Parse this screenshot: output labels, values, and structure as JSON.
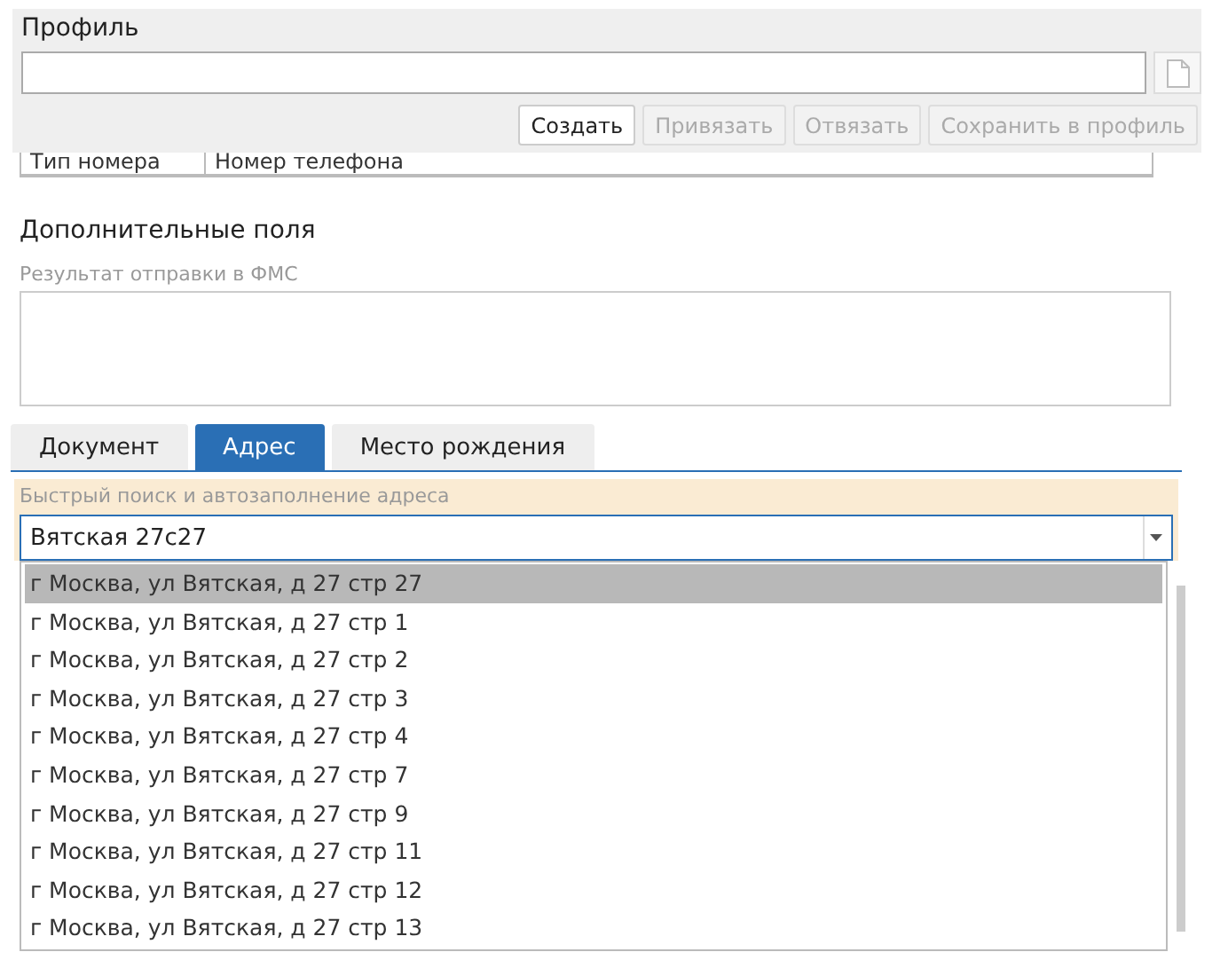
{
  "profile": {
    "title": "Профиль",
    "buttons": [
      {
        "label": "Создать",
        "disabled": false
      },
      {
        "label": "Привязать",
        "disabled": true
      },
      {
        "label": "Отвязать",
        "disabled": true
      },
      {
        "label": "Сохранить в профиль",
        "disabled": true
      }
    ]
  },
  "phone_table": {
    "columns": [
      "Тип номера",
      "Номер телефона"
    ]
  },
  "extra": {
    "title": "Дополнительные поля",
    "fms_label": "Результат отправки в ФМС"
  },
  "tabs": [
    {
      "label": "Документ",
      "selected": false
    },
    {
      "label": "Адрес",
      "selected": true
    },
    {
      "label": "Место рождения",
      "selected": false
    }
  ],
  "address": {
    "label": "Быстрый поиск и автозаполнение адреса",
    "value": "Вятская 27с27",
    "suggestions": [
      {
        "text": "г Москва, ул Вятская, д 27 стр 27",
        "selected": true
      },
      {
        "text": "г Москва, ул Вятская, д 27 стр 1",
        "selected": false
      },
      {
        "text": "г Москва, ул Вятская, д 27 стр 2",
        "selected": false
      },
      {
        "text": "г Москва, ул Вятская, д 27 стр 3",
        "selected": false
      },
      {
        "text": "г Москва, ул Вятская, д 27 стр 4",
        "selected": false
      },
      {
        "text": "г Москва, ул Вятская, д 27 стр 7",
        "selected": false
      },
      {
        "text": "г Москва, ул Вятская, д 27 стр 9",
        "selected": false
      },
      {
        "text": "г Москва, ул Вятская, д 27 стр 11",
        "selected": false
      },
      {
        "text": "г Москва, ул Вятская, д 27 стр 12",
        "selected": false
      },
      {
        "text": "г Москва, ул Вятская, д 27 стр 13",
        "selected": false
      }
    ]
  }
}
